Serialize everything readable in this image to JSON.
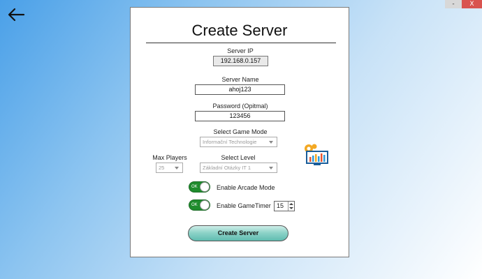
{
  "window": {
    "minimize_label": "-",
    "close_label": "X"
  },
  "page": {
    "title": "Create Server"
  },
  "form": {
    "server_ip_label": "Server IP",
    "server_ip_value": "192.168.0.157",
    "server_name_label": "Server Name",
    "server_name_value": "ahoj123",
    "password_label": "Password (Opitmal)",
    "password_value": "123456",
    "game_mode_label": "Select Game Mode",
    "game_mode_value": "Informační Technologie",
    "max_players_label": "Max Players",
    "max_players_value": "25",
    "level_label": "Select Level",
    "level_value": "Základní Otázky IT 1",
    "arcade_label": "Enable Arcade Mode",
    "arcade_toggle_text": "OK",
    "gametimer_label": "Enable GameTimer",
    "gametimer_toggle_text": "OK",
    "gametimer_value": "15",
    "create_button_label": "Create Server"
  },
  "icons": {
    "back": "back-arrow-icon",
    "monitor": "monitor-settings-icon"
  },
  "colors": {
    "toggle_on": "#1f8c2d",
    "button_gradient_end": "#5fbcb0",
    "background_start": "#4aa0e8"
  },
  "state": {
    "arcade_enabled": true,
    "gametimer_enabled": true
  }
}
